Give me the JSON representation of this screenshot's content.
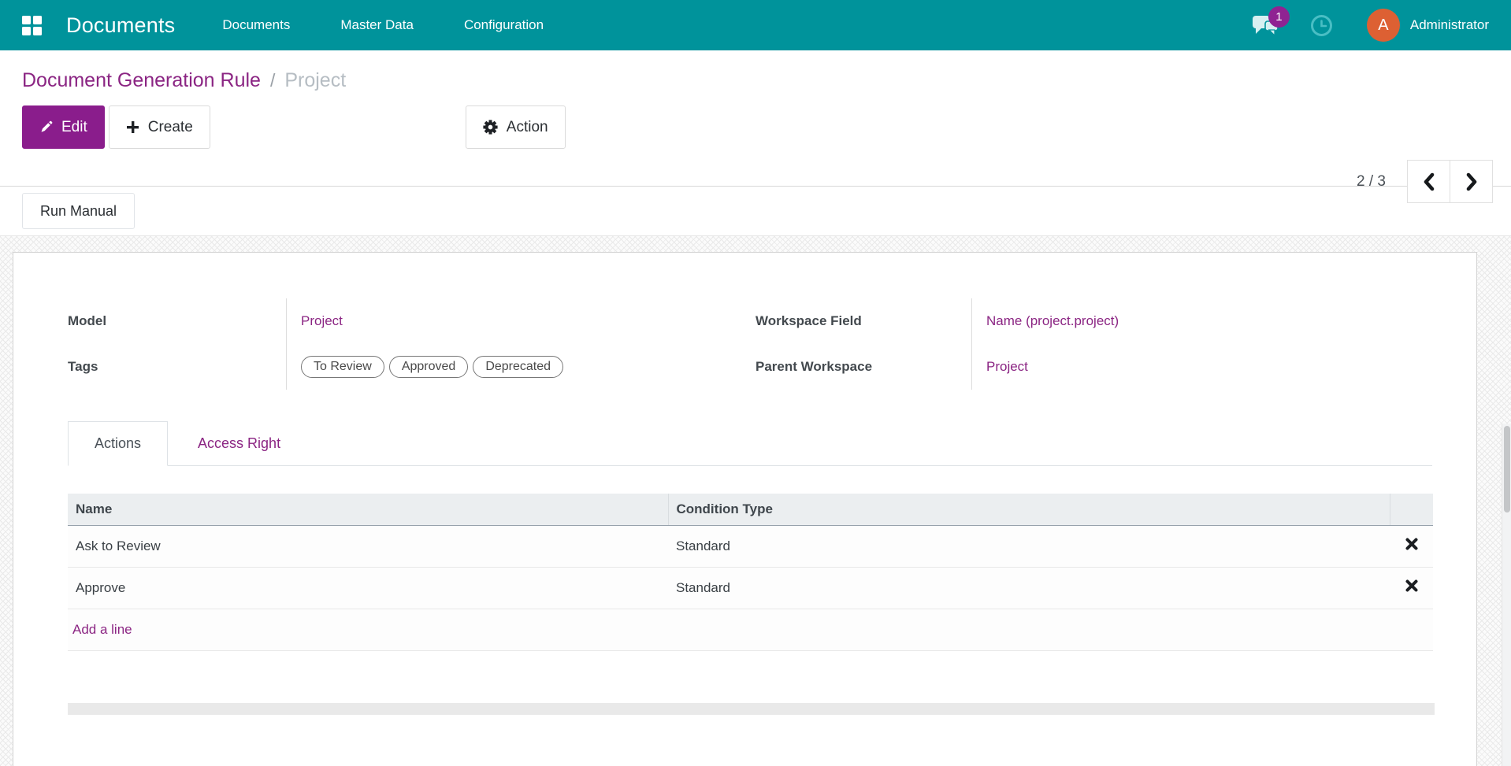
{
  "navbar": {
    "app_title": "Documents",
    "menu_items": [
      "Documents",
      "Master Data",
      "Configuration"
    ],
    "messages_badge": "1",
    "user": {
      "initial": "A",
      "name": "Administrator"
    }
  },
  "breadcrumb": {
    "parent": "Document Generation Rule",
    "separator": "/",
    "current": "Project"
  },
  "control_panel": {
    "edit_label": "Edit",
    "create_label": "Create",
    "action_label": "Action",
    "pager_value": "2 / 3"
  },
  "statusbar": {
    "run_manual_label": "Run Manual"
  },
  "form": {
    "model": {
      "label": "Model",
      "value": "Project"
    },
    "tags": {
      "label": "Tags",
      "items": [
        "To Review",
        "Approved",
        "Deprecated"
      ]
    },
    "workspace_field": {
      "label": "Workspace Field",
      "value": "Name (project.project)"
    },
    "parent_workspace": {
      "label": "Parent Workspace",
      "value": "Project"
    }
  },
  "notebook": {
    "tabs": [
      {
        "label": "Actions"
      },
      {
        "label": "Access Right"
      }
    ]
  },
  "actions_table": {
    "columns": [
      "Name",
      "Condition Type"
    ],
    "rows": [
      {
        "name": "Ask to Review",
        "condition_type": "Standard"
      },
      {
        "name": "Approve",
        "condition_type": "Standard"
      }
    ],
    "add_line_label": "Add a line"
  },
  "colors": {
    "navbar_teal": "#00939B",
    "primary_purple": "#8A1D8C",
    "link_purple": "#8B2583",
    "badge_purple": "#8F2392",
    "avatar_orange": "#DD6033"
  }
}
